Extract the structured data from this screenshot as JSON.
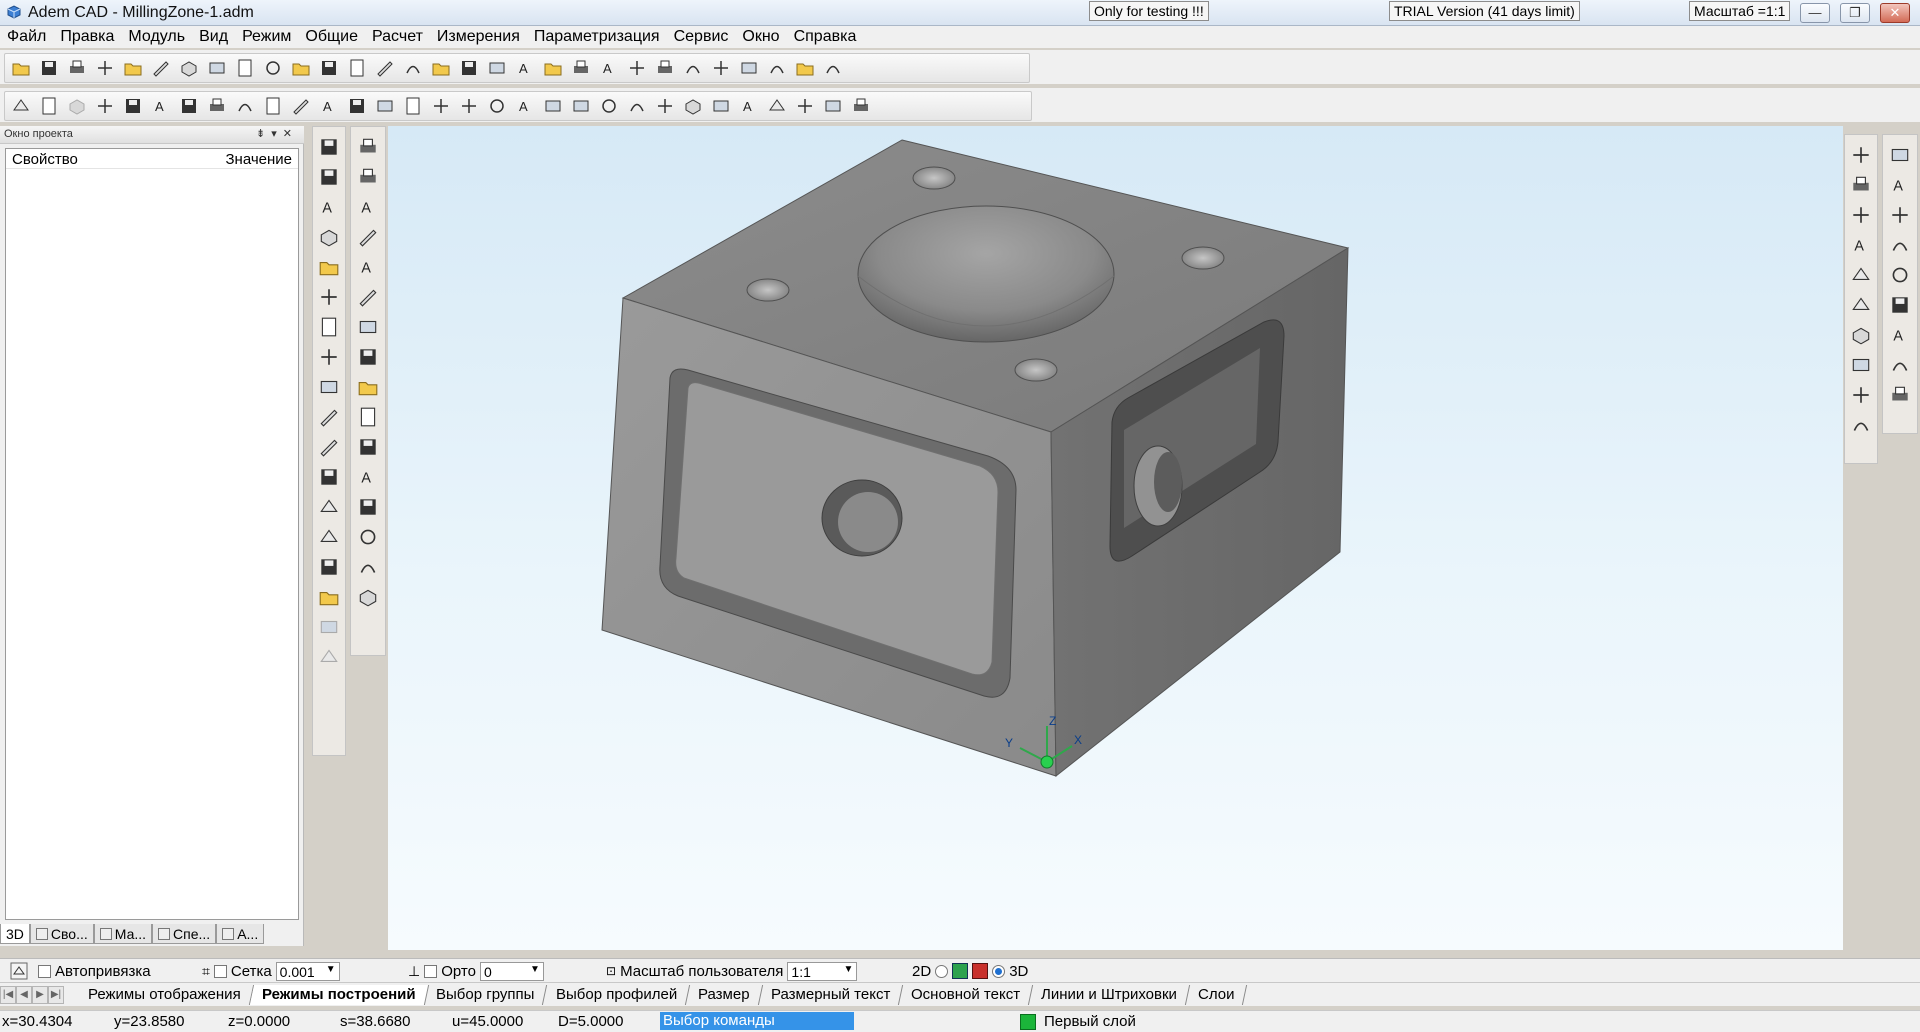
{
  "window": {
    "title": "Adem CAD - MillingZone-1.adm",
    "notice_testing": "Only for testing !!!",
    "notice_trial": "TRIAL Version (41 days limit)",
    "scale_label": "Масштаб =1:1",
    "buttons": [
      "minimize",
      "restore",
      "close"
    ]
  },
  "menu": [
    "Файл",
    "Правка",
    "Модуль",
    "Вид",
    "Режим",
    "Общие",
    "Расчет",
    "Измерения",
    "Параметризация",
    "Сервис",
    "Окно",
    "Справка"
  ],
  "toolbar_row1": [
    "new-file-icon",
    "open-folder-icon",
    "save-icon",
    "print-icon",
    "copy-view-icon",
    "paste-view-icon",
    "line-pencil-icon",
    "curve-icon",
    "circle-icon",
    "chamfer-icon",
    "surface-icon",
    "box-solid-icon",
    "box-cut-icon",
    "extrude-icon",
    "loft-icon",
    "sweep-icon",
    "shell-icon",
    "sphere-icon",
    "revolve-icon",
    "cup-icon",
    "database-icon",
    "sort-icon",
    "filter-icon",
    "export-icon",
    "import-icon",
    "cube-icon",
    "snap-icon",
    "orbit-icon",
    "pan-icon",
    "grid-icon"
  ],
  "toolbar_row2": [
    "camera-icon",
    "properties-icon",
    "save-disabled-icon",
    "page-icon",
    "page-check-icon",
    "page-edit-icon",
    "undo-icon",
    "redo-icon",
    "segment-icon",
    "rectangle-icon",
    "circle-center-icon",
    "arc-icon",
    "polyline-icon",
    "spline-icon",
    "polygon-icon",
    "bezier-icon",
    "hatch-icon",
    "hatch-alt-icon",
    "fill-icon",
    "text-icon",
    "text-edit-icon",
    "dimension-icon",
    "check-dimension-icon",
    "tolerance-icon",
    "angle-dimension-icon",
    "arrow-icon",
    "align-icon",
    "rect-align-icon",
    "fillet-icon",
    "offset-icon",
    "mirror-icon"
  ],
  "project_panel": {
    "header": "Окно проекта",
    "col_property": "Свойство",
    "col_value": "Значение",
    "tabs": [
      "3D",
      "Сво...",
      "Ма...",
      "Спе...",
      "А..."
    ]
  },
  "left_tools_a": [
    "solid-select-icon",
    "solid-delete-icon",
    "solid-copy-icon",
    "solid-move-icon",
    "rotate-icon",
    "array-icon",
    "boolean-icon",
    "union-icon",
    "subtract-icon",
    "intersect-icon",
    "split-icon",
    "section-icon",
    "projection-icon",
    "transform-icon",
    "layer-list-icon",
    "report-icon",
    "align-disabled-icon",
    "gear-disabled-icon"
  ],
  "left_tools_b": [
    "block-add-icon",
    "cylinder-add-icon",
    "cone-add-icon",
    "delete-solid-icon",
    "sphere-add-icon",
    "torus-delete-icon",
    "plane-up-icon",
    "plane-down-icon",
    "face-icon",
    "face-green-icon",
    "face-edit-icon",
    "surface-plane-icon",
    "grid-surface-icon",
    "hatch-surface-icon",
    "axis-icon",
    "view-cube-icon"
  ],
  "right_tools_a": [
    "line-3d-icon",
    "polygon-3d-icon",
    "circle-3d-icon",
    "triangle-3d-icon",
    "scissors-icon",
    "trim-icon",
    "extend-icon",
    "page-3d-icon",
    "accept-icon",
    "pattern-icon"
  ],
  "right_tools_b": [
    "plane-3d-icon",
    "fill-yellow-icon",
    "shade-yellow-icon",
    "highlight-icon",
    "copy-face-icon",
    "rotate-face-icon",
    "delete-face-icon",
    "paint-icon",
    "checker-icon"
  ],
  "viewport": {
    "axis_x": "X",
    "axis_y": "Y",
    "axis_z": "Z"
  },
  "options_bar": {
    "autosnap": "Автопривязка",
    "grid": "Сетка",
    "grid_value": "0.001",
    "ortho": "Орто",
    "ortho_value": "0",
    "user_scale": "Масштаб пользователя",
    "user_scale_value": "1:1",
    "mode_2d": "2D",
    "mode_3d": "3D",
    "selected_mode": "3D"
  },
  "sheet_tabs": [
    "Режимы отображения",
    "Режимы построений",
    "Выбор группы",
    "Выбор профилей",
    "Размер",
    "Размерный текст",
    "Основной текст",
    "Линии и Штриховки",
    "Слои"
  ],
  "active_sheet_tab": "Режимы построений",
  "status": {
    "x": "x=30.4304",
    "y": "y=23.8580",
    "z": "z=0.0000",
    "s": "s=38.6680",
    "u": "u=45.0000",
    "d": "D=5.0000",
    "command": "Выбор команды",
    "layer": "Первый слой",
    "layer_color": "#1bb53a"
  }
}
